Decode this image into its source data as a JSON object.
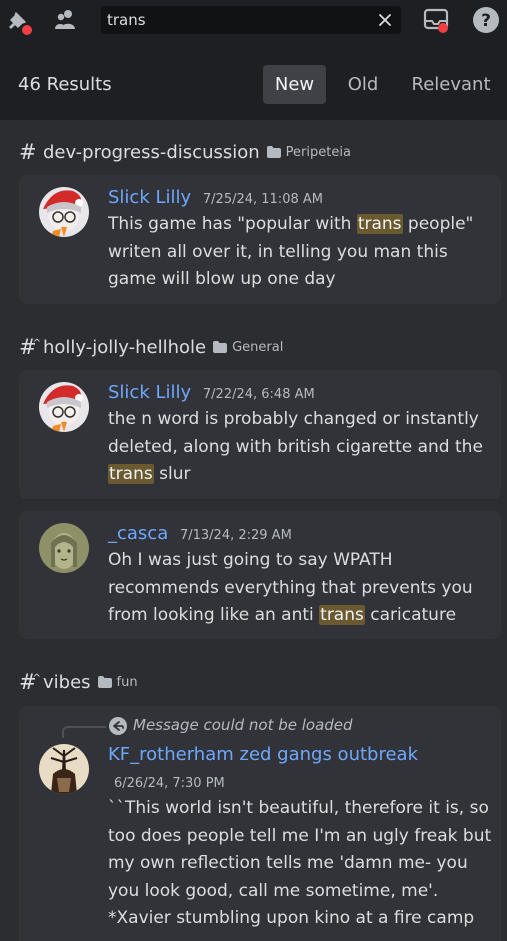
{
  "topbar": {
    "search_value": "trans",
    "icons": [
      "pin-icon",
      "members-icon",
      "clear-icon",
      "inbox-icon",
      "help-icon"
    ]
  },
  "results": {
    "count_label": "46 Results",
    "sort_tabs": [
      "New",
      "Old",
      "Relevant"
    ],
    "active_sort": "New"
  },
  "groups": [
    {
      "channel": "dev-progress-discussion",
      "category": "Peripeteia",
      "messages": [
        {
          "author": "Slick Lilly",
          "timestamp": "7/25/24, 11:08 AM",
          "parts": [
            "This game has \"popular with ",
            "trans",
            " people\" writen all over it, in telling you man this game will blow up one day"
          ]
        }
      ]
    },
    {
      "channel": "holly-jolly-hellhole",
      "category": "General",
      "messages": [
        {
          "author": "Slick Lilly",
          "timestamp": "7/22/24, 6:48 AM",
          "parts": [
            "the n word is probably changed or instantly deleted, along with british cigarette and the ",
            "trans",
            " slur"
          ]
        },
        {
          "author": "_casca",
          "timestamp": "7/13/24, 2:29 AM",
          "parts": [
            "Oh I was just going to say WPATH recommends everything that prevents you from looking like an anti ",
            "trans",
            " caricature"
          ]
        }
      ]
    },
    {
      "channel": "vibes",
      "category": "fun",
      "messages": [
        {
          "reply_note": "Message could not be loaded",
          "author": "KF_rotherham zed gangs outbreak",
          "timestamp": "6/26/24, 7:30 PM",
          "text": "``This world isn't beautiful, therefore it is, so too does people tell me I'm an ugly freak but my own reflection tells me 'damn me- you you look good, call me sometime, me'. *Xavier stumbling upon kino at a fire camp"
        }
      ]
    }
  ],
  "colors": {
    "background": "#2b2d31",
    "topbar": "#1e1f22",
    "card": "#313338",
    "author": "#6ea8fe",
    "highlight": "#6b5a30",
    "notification": "#f23f43"
  }
}
